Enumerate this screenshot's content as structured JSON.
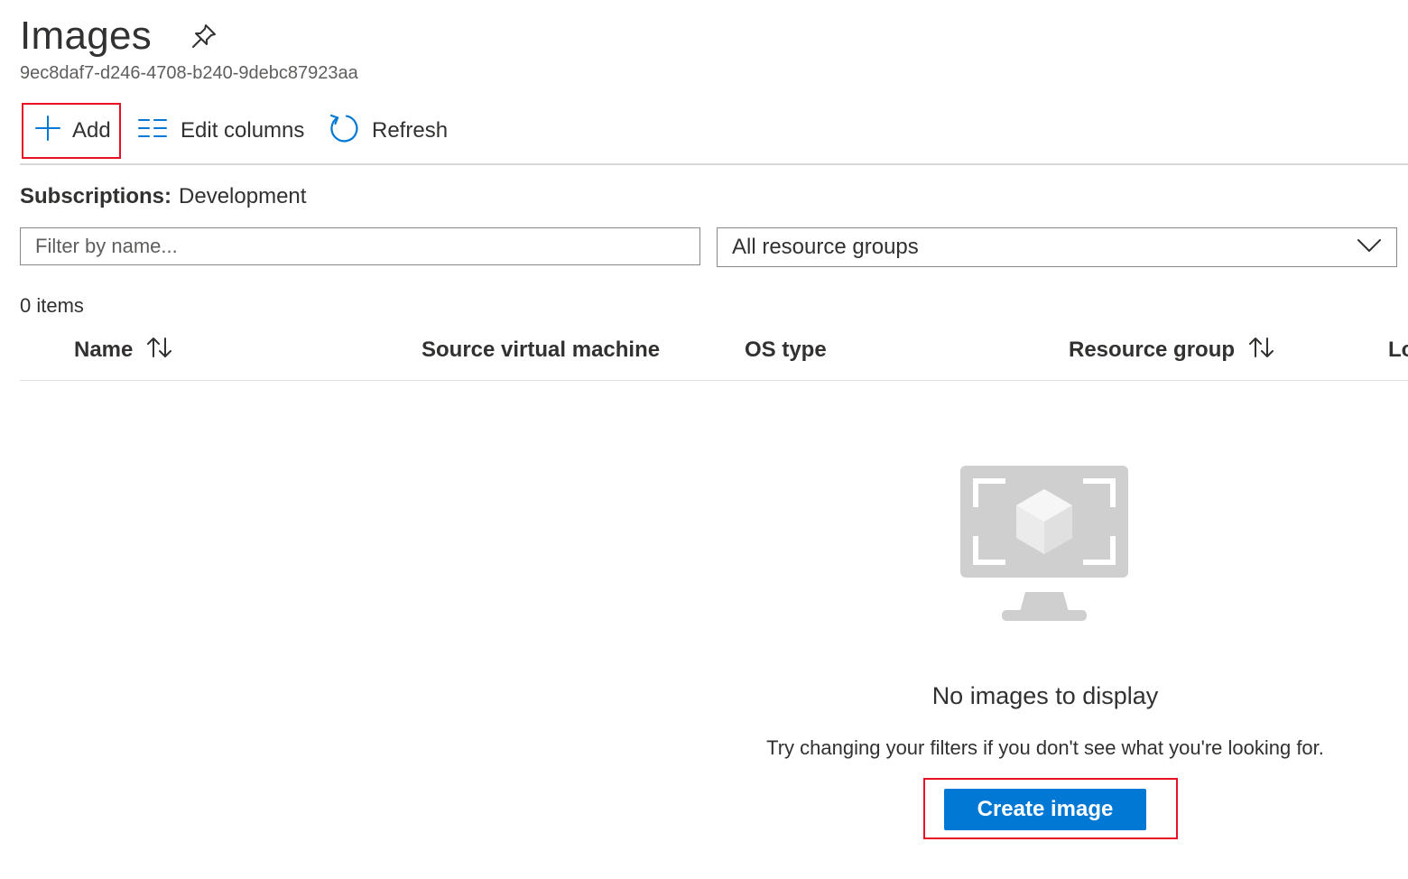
{
  "header": {
    "title": "Images",
    "subtitle": "9ec8daf7-d246-4708-b240-9debc87923aa"
  },
  "toolbar": {
    "add_label": "Add",
    "edit_columns_label": "Edit columns",
    "refresh_label": "Refresh",
    "icons": [
      "plus-icon",
      "list-columns-icon",
      "refresh-icon"
    ]
  },
  "subscriptions": {
    "label": "Subscriptions:",
    "value": "Development"
  },
  "filters": {
    "name_placeholder": "Filter by name...",
    "name_value": "",
    "resource_group_selected": "All resource groups"
  },
  "grid": {
    "item_count": "0 items",
    "columns": [
      {
        "label": "Name",
        "sortable": true
      },
      {
        "label": "Source virtual machine",
        "sortable": false
      },
      {
        "label": "OS type",
        "sortable": false
      },
      {
        "label": "Resource group",
        "sortable": true
      },
      {
        "label": "Lo",
        "sortable": false
      }
    ],
    "rows": []
  },
  "empty_state": {
    "title": "No images to display",
    "description": "Try changing your filters if you don't see what you're looking for.",
    "action_label": "Create image"
  },
  "colors": {
    "accent": "#0078d4",
    "highlight": "#e81123",
    "text": "#323130"
  }
}
